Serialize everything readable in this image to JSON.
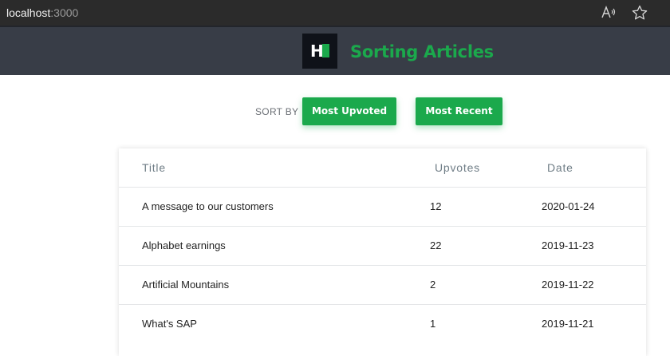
{
  "browser": {
    "url_host": "localhost",
    "url_port": ":3000",
    "icons": [
      "read-aloud-icon",
      "favorite-star-icon"
    ]
  },
  "header": {
    "logo_text": "H",
    "title": "Sorting Articles",
    "accent_color": "#1ba94c",
    "background_color": "#383d47"
  },
  "sort": {
    "label": "SORT BY",
    "buttons": [
      "Most Upvoted",
      "Most Recent"
    ]
  },
  "table": {
    "columns": [
      "Title",
      "Upvotes",
      "Date"
    ],
    "rows": [
      {
        "title": "A message to our customers",
        "upvotes": "12",
        "date": "2020-01-24"
      },
      {
        "title": "Alphabet earnings",
        "upvotes": "22",
        "date": "2019-11-23"
      },
      {
        "title": "Artificial Mountains",
        "upvotes": "2",
        "date": "2019-11-22"
      },
      {
        "title": "What's SAP",
        "upvotes": "1",
        "date": "2019-11-21"
      }
    ]
  }
}
